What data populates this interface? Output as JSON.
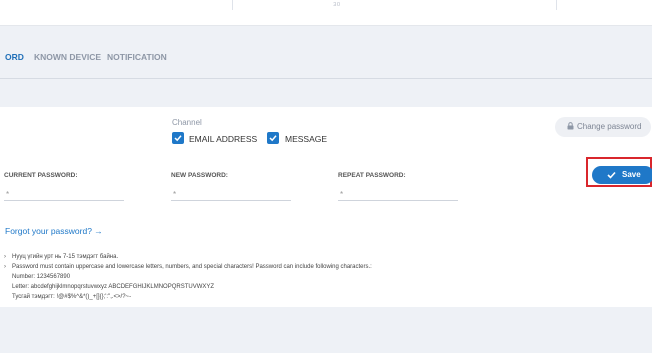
{
  "topbar": {
    "peek_left": "...",
    "peek_right": "...",
    "sliver": "₃₀"
  },
  "tabs": [
    {
      "label": "ORD",
      "active": true
    },
    {
      "label": "KNOWN DEVICE",
      "active": false
    },
    {
      "label": "NOTIFICATION",
      "active": false
    }
  ],
  "channel": {
    "label": "Channel",
    "options": [
      {
        "label": "EMAIL ADDRESS",
        "checked": true
      },
      {
        "label": "MESSAGE",
        "checked": true
      }
    ]
  },
  "change_password": {
    "label": "Change password"
  },
  "fields": {
    "current": {
      "label": "CURRENT PASSWORD:",
      "value": "*"
    },
    "new": {
      "label": "NEW PASSWORD:",
      "value": "*"
    },
    "repeat": {
      "label": "REPEAT PASSWORD:",
      "value": "*"
    }
  },
  "save": {
    "label": "Save"
  },
  "forgot": {
    "label": "Forgot your password? →"
  },
  "rules": {
    "line1": "Нууц үгийн урт нь 7-15 тэмдэгт байна.",
    "line2": "Password must contain uppercase and lowercase letters, numbers, and special characters! Password can include following characters.:",
    "line3": "Number: 1234567890",
    "line4": "Letter: abcdefghijklmnopqrstuvwxyz ABCDEFGHIJKLMNOPQRSTUVWXYZ",
    "line5": "Тусгай тэмдэгт: !@#$%^&*()_+[]{};':\",.<>/?~-"
  },
  "colors": {
    "accent": "#1f78c8",
    "highlight": "#d9262c",
    "tab_active": "#1f6fb8"
  }
}
